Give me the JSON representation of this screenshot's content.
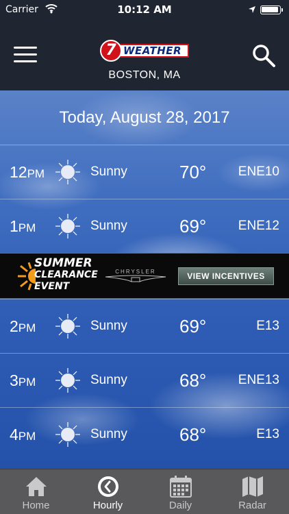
{
  "status_bar": {
    "carrier": "Carrier",
    "time": "10:12 AM"
  },
  "header": {
    "logo_number": "7",
    "logo_text": "WEATHER",
    "location": "BOSTON, MA"
  },
  "forecast": {
    "date": "Today, August 28, 2017",
    "hours": [
      {
        "hour": "12",
        "period": "PM",
        "condition": "Sunny",
        "temp": "70°",
        "wind": "ENE10"
      },
      {
        "hour": "1",
        "period": "PM",
        "condition": "Sunny",
        "temp": "69°",
        "wind": "ENE12"
      },
      {
        "hour": "2",
        "period": "PM",
        "condition": "Sunny",
        "temp": "69°",
        "wind": "E13"
      },
      {
        "hour": "3",
        "period": "PM",
        "condition": "Sunny",
        "temp": "68°",
        "wind": "ENE13"
      },
      {
        "hour": "4",
        "period": "PM",
        "condition": "Sunny",
        "temp": "68°",
        "wind": "E13"
      }
    ]
  },
  "ad": {
    "line1": "SUMMER",
    "line2": "CLEARANCE",
    "line3": "EVENT",
    "brand": "CHRYSLER",
    "cta": "VIEW INCENTIVES"
  },
  "tabs": [
    {
      "label": "Home",
      "icon": "home-icon"
    },
    {
      "label": "Hourly",
      "icon": "clock-icon"
    },
    {
      "label": "Daily",
      "icon": "calendar-icon"
    },
    {
      "label": "Radar",
      "icon": "map-icon"
    }
  ],
  "active_tab": "Hourly",
  "colors": {
    "header_bg": "#1f2632",
    "tab_bar_bg": "#59595c",
    "logo_red": "#d0121b",
    "sky_blue": "#2f5db5"
  }
}
